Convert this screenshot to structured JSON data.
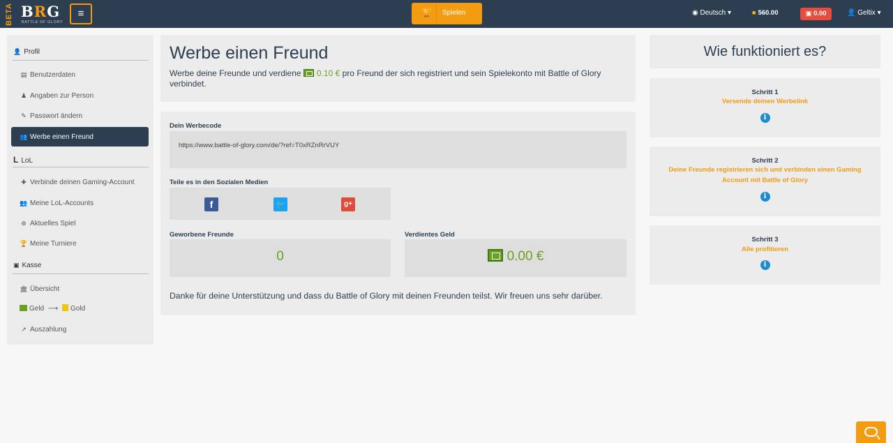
{
  "header": {
    "beta": "BETA",
    "logo_main_left": "B",
    "logo_main_o": "R",
    "logo_main_right": "G",
    "logo_sub": "BATTLE OF GLORY",
    "menu_icon": "hamburger-icon",
    "play_label": "Spielen",
    "play_icon": "trophy-icon",
    "language": "Deutsch",
    "coins": "560.00",
    "money": "0.00",
    "username": "Geltix"
  },
  "sidebar": {
    "sections": [
      {
        "title": "Profil",
        "items": [
          "Benutzerdaten",
          "Angaben zur Person",
          "Passwort ändern",
          "Werbe einen Freund"
        ]
      },
      {
        "title": "LoL",
        "items": [
          "Verbinde deinen Gaming-Account",
          "Meine LoL-Accounts",
          "Aktuelles Spiel",
          "Meine Turniere"
        ]
      },
      {
        "title": "Kasse",
        "items": [
          "Übersicht",
          "Geld",
          "Gold",
          "Auszahlung"
        ]
      }
    ],
    "active": "Werbe einen Freund"
  },
  "main": {
    "title": "Werbe einen Freund",
    "intro_before": "Werbe deine Freunde und verdiene",
    "intro_amount": "0.10 €",
    "intro_after": "pro Freund der sich registriert und sein Spielekonto mit Battle of Glory verbindet.",
    "code_label": "Dein Werbecode",
    "code_value": "https://www.battle-of-glory.com/de/?ref=T0xRZnRrVUY",
    "social_label": "Teile es in den Sozialen Medien",
    "friends_label": "Geworbene Freunde",
    "friends_value": "0",
    "earned_label": "Verdientes Geld",
    "earned_value": "0.00 €",
    "thanks": "Danke für deine Unterstützung und dass du Battle of Glory mit deinen Freunden teilst. Wir freuen uns sehr darüber."
  },
  "how": {
    "title": "Wie funktioniert es?",
    "steps": [
      {
        "title": "Schritt 1",
        "desc": "Versende deinen Werbelink"
      },
      {
        "title": "Schritt 2",
        "desc": "Deine Freunde registrieren sich und verbinden einen Gaming Account mit Battle of Glory"
      },
      {
        "title": "Schritt 3",
        "desc": "Alle profitieren"
      }
    ]
  },
  "colors": {
    "navbar": "#2c3e50",
    "accent": "#f39c12",
    "money_badge": "#e74c3c",
    "earning_green": "#6aa121",
    "info_blue": "#1a8ccf"
  }
}
